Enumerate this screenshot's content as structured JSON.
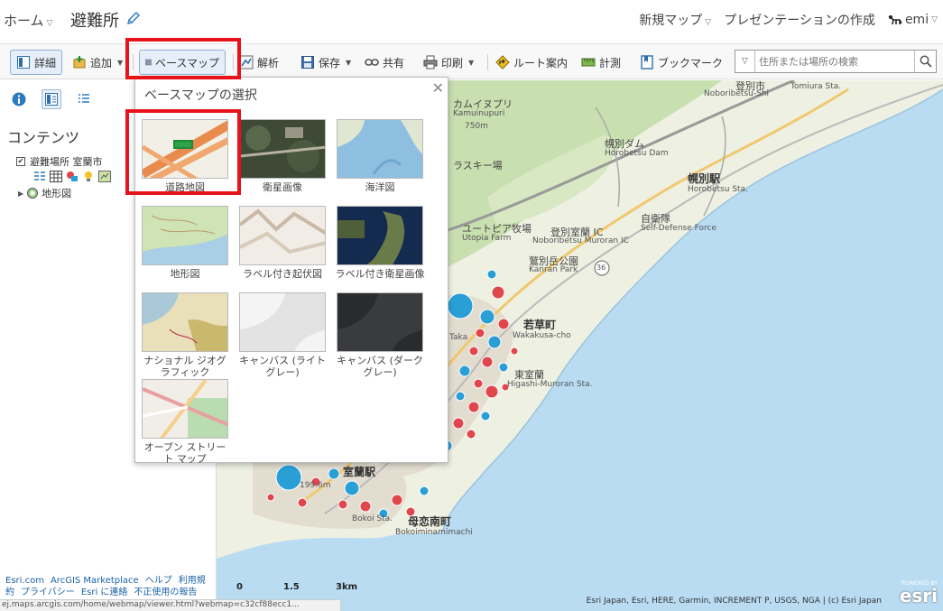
{
  "header": {
    "home_label": "ホーム",
    "map_title": "避難所",
    "new_map": "新規マップ",
    "create_presentation": "プレゼンテーションの作成",
    "user_name": "emi"
  },
  "toolbar": {
    "details": "詳細",
    "add": "追加",
    "basemap": "ベースマップ",
    "analysis": "解析",
    "save": "保存",
    "share": "共有",
    "print": "印刷",
    "directions": "ルート案内",
    "measure": "計測",
    "bookmarks": "ブックマーク",
    "search_placeholder": "住所または場所の検索"
  },
  "left_panel": {
    "contents_title": "コンテンツ",
    "layers": [
      {
        "name": "避難場所 室蘭市",
        "checked": true
      },
      {
        "name": "地形図",
        "collapsed": true
      }
    ],
    "footer_links": [
      "Esri.com",
      "ArcGIS Marketplace",
      "ヘルプ",
      "利用規約",
      "プライバシー",
      "Esri に連絡",
      "不正使用の報告"
    ]
  },
  "status_url": "ej.maps.arcgis.com/home/webmap/viewer.html?webmap=c32cf88ecc1...",
  "basemap_gallery": {
    "title": "ベースマップの選択",
    "items": [
      {
        "label": "道路地図",
        "thumb": "streets"
      },
      {
        "label": "衛星画像",
        "thumb": "imagery"
      },
      {
        "label": "海洋図",
        "thumb": "oceans"
      },
      {
        "label": "地形図",
        "thumb": "topographic"
      },
      {
        "label": "ラベル付き起伏図",
        "thumb": "terrain-labels"
      },
      {
        "label": "ラベル付き衛星画像",
        "thumb": "imagery-labels"
      },
      {
        "label": "ナショナル ジオグラフィック",
        "thumb": "natgeo"
      },
      {
        "label": "キャンバス (ライト グレー)",
        "thumb": "light-gray"
      },
      {
        "label": "キャンバス (ダーク グレー)",
        "thumb": "dark-gray"
      },
      {
        "label": "オープン ストリート マップ",
        "thumb": "osm"
      }
    ]
  },
  "map": {
    "labels": {
      "noboribetsu_shi_kanji": "登別市",
      "noboribetsu_shi": "Noboribetsu-Shi",
      "tomiura_sta": "Tomiura Sta.",
      "kamui": "カムイヌプリ",
      "kamui_en": "Kamuinupuri",
      "elev_750": "750m",
      "horobetsu_dam": "幌別ダム",
      "horobetsu_dam_en": "Horobetsu Dam",
      "ski": "ラスキー場",
      "horobetsu_sta_kanji": "幌別駅",
      "horobetsu_sta": "Horobetsu Sta.",
      "utopia": "ユートピア牧場",
      "utopia_en": "Utopia Farm",
      "ic": "登別室蘭 IC",
      "ic_en": "Noboribetsu Muroran IC",
      "sdf": "自衛隊",
      "sdf_en": "Self-Defense Force",
      "kanran": "鷲別岳公園",
      "kanran_en": "Kanran Park",
      "route36": "36",
      "wakakusa": "若草町",
      "wakakusa_en": "Wakakusa-cho",
      "higashi": "東室蘭",
      "higashi_en": "Higashi-Muroran Sta.",
      "muroran_sta": "室蘭駅",
      "elev_199": "199.6m",
      "bokoi_sta": "Bokoi Sta.",
      "bokoi_cho": "母恋南町",
      "bokoi_en": "Bokoiminamimachi",
      "takasago": "Taka"
    },
    "scale": {
      "labels": [
        "0",
        "1.5",
        "3km"
      ]
    },
    "attribution": "Esri Japan, Esri, HERE, Garmin, INCREMENT P, USGS, NGA | (c) Esri Japan",
    "esri_powered": "POWERED BY",
    "esri_word": "esri"
  },
  "colors": {
    "highlight": "#e8121b",
    "sea": "#b6d9f0",
    "land": "#eef0e2",
    "point_red": "#e0474c",
    "point_blue": "#2a9fd6",
    "link": "#1a62a8"
  }
}
